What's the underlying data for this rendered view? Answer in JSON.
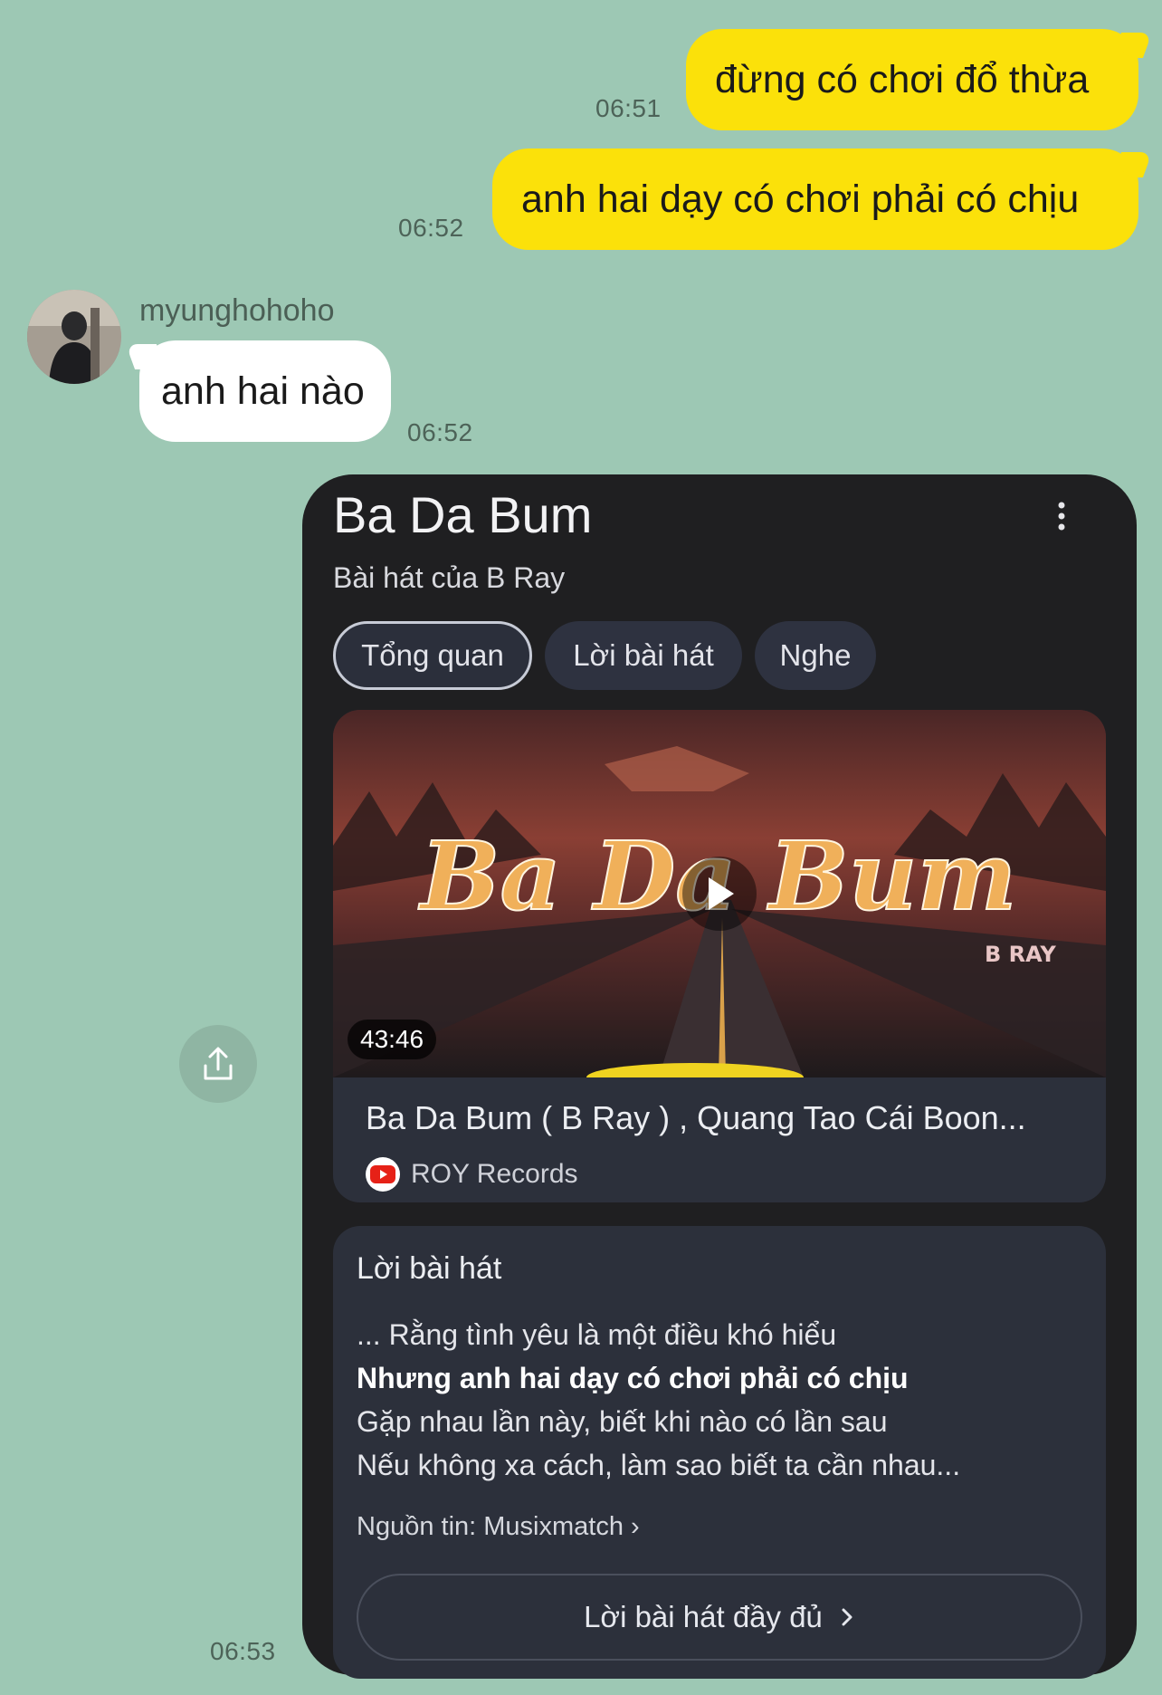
{
  "messages": [
    {
      "text": "đừng có chơi đổ thừa",
      "time": "06:51"
    },
    {
      "text": "anh hai dạy có chơi phải có chịu",
      "time": "06:52"
    }
  ],
  "incoming": {
    "sender": "myunghohoho",
    "text": "anh hai nào",
    "time": "06:52"
  },
  "card": {
    "title": "Ba Da Bum",
    "subtitle": "Bài hát của B Ray",
    "tabs": [
      "Tổng quan",
      "Lời bài hát",
      "Nghe"
    ],
    "video": {
      "thumb_title": "Ba Da Bum",
      "thumb_artist": "B RAY",
      "duration": "43:46",
      "title": "Ba Da Bum ( B Ray ) , Quang Tao Cái Boon...",
      "channel": "ROY Records"
    },
    "lyrics": {
      "heading": "Lời bài hát",
      "lines": [
        "... Rằng tình yêu là một điều khó hiểu",
        "Nhưng anh hai dạy có chơi phải có chịu",
        "Gặp nhau lần này, biết khi nào có lần sau",
        "Nếu không xa cách, làm sao biết ta cần nhau..."
      ],
      "source": "Nguồn tin: Musixmatch ›",
      "full_button": "Lời bài hát đầy đủ"
    },
    "time": "06:53"
  },
  "colors": {
    "background": "#9dc8b4",
    "outgoing_bubble": "#fbe10a",
    "card": "#1f1f21"
  }
}
